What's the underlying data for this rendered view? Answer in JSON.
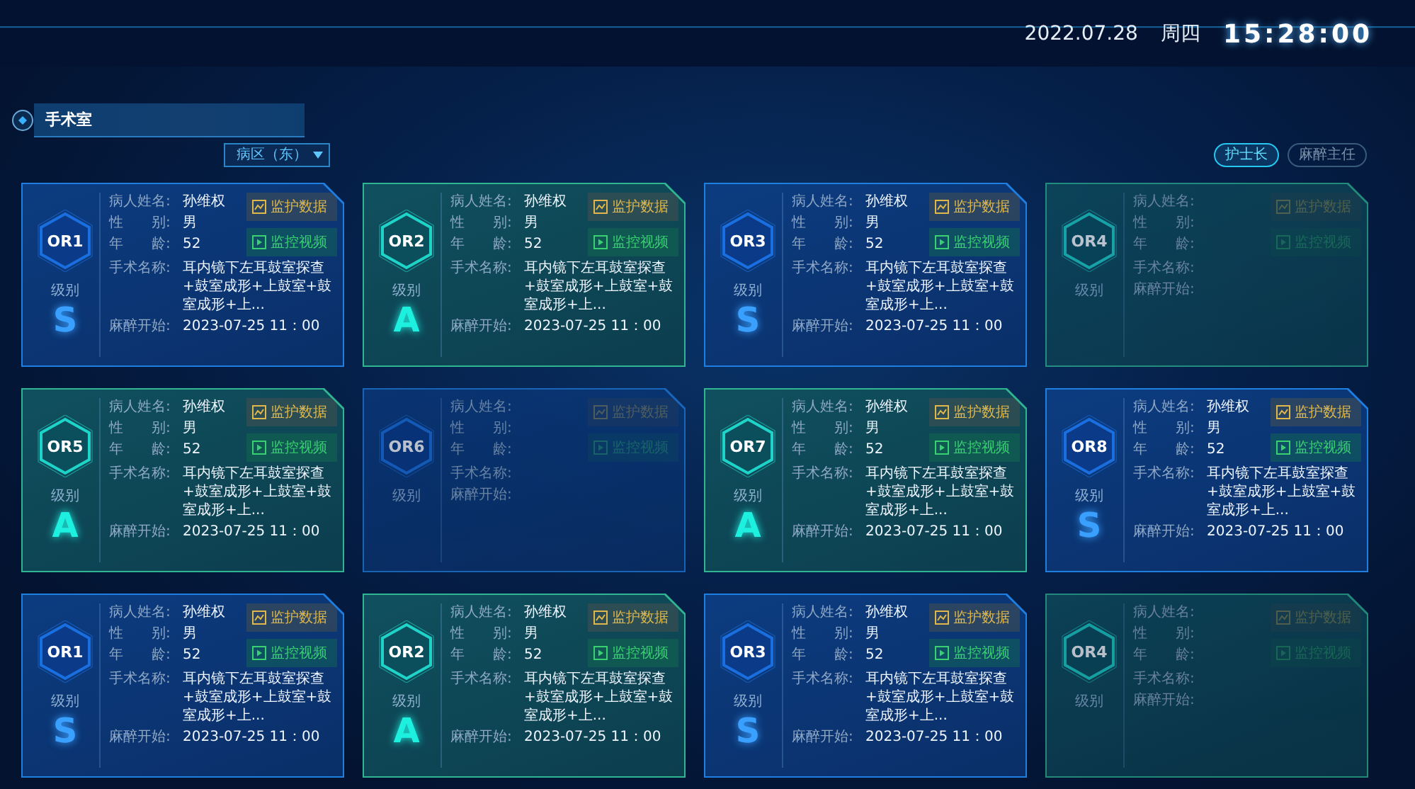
{
  "header": {
    "date": "2022.07.28",
    "weekday": "周四",
    "time": "15:28:00"
  },
  "section": {
    "title": "手术室"
  },
  "ward_select": {
    "value": "病区（东）"
  },
  "roles": [
    {
      "label": "护士长",
      "selected": true
    },
    {
      "label": "麻醉主任",
      "selected": false
    }
  ],
  "cards": [
    {
      "room": "OR1",
      "kind": "blue",
      "grade_label": "级别",
      "grade": "S",
      "fields": [
        {
          "label": "病人姓名:",
          "value": "孙维权"
        },
        {
          "label": "性　　别:",
          "value": "男"
        },
        {
          "label": "年　　龄:",
          "value": "52"
        },
        {
          "label": "手术名称:",
          "value": "耳内镜下左耳鼓室探查+鼓室成形+上鼓室+鼓室成形+上..."
        },
        {
          "label": "麻醉开始:",
          "value": "2023-07-25 11：00"
        }
      ],
      "buttons": [
        {
          "kind": "monitor",
          "label": "监护数据",
          "disabled": false
        },
        {
          "kind": "video",
          "label": "监控视频",
          "disabled": false
        }
      ]
    },
    {
      "room": "OR2",
      "kind": "green",
      "grade_label": "级别",
      "grade": "A",
      "fields": [
        {
          "label": "病人姓名:",
          "value": "孙维权"
        },
        {
          "label": "性　　别:",
          "value": "男"
        },
        {
          "label": "年　　龄:",
          "value": "52"
        },
        {
          "label": "手术名称:",
          "value": "耳内镜下左耳鼓室探查+鼓室成形+上鼓室+鼓室成形+上..."
        },
        {
          "label": "麻醉开始:",
          "value": "2023-07-25 11：00"
        }
      ],
      "buttons": [
        {
          "kind": "monitor",
          "label": "监护数据",
          "disabled": false
        },
        {
          "kind": "video",
          "label": "监控视频",
          "disabled": false
        }
      ]
    },
    {
      "room": "OR3",
      "kind": "blue",
      "grade_label": "级别",
      "grade": "S",
      "fields": [
        {
          "label": "病人姓名:",
          "value": "孙维权"
        },
        {
          "label": "性　　别:",
          "value": "男"
        },
        {
          "label": "年　　龄:",
          "value": "52"
        },
        {
          "label": "手术名称:",
          "value": "耳内镜下左耳鼓室探查+鼓室成形+上鼓室+鼓室成形+上..."
        },
        {
          "label": "麻醉开始:",
          "value": "2023-07-25 11：00"
        }
      ],
      "buttons": [
        {
          "kind": "monitor",
          "label": "监护数据",
          "disabled": false
        },
        {
          "kind": "video",
          "label": "监控视频",
          "disabled": false
        }
      ]
    },
    {
      "room": "OR4",
      "kind": "green",
      "grade_label": "级别",
      "fields": [
        {
          "label": "病人姓名:"
        },
        {
          "label": "性　　别:"
        },
        {
          "label": "年　　龄:"
        },
        {
          "label": "手术名称:"
        },
        {
          "label": "麻醉开始:"
        }
      ],
      "buttons": [
        {
          "kind": "monitor",
          "label": "监护数据",
          "disabled": true
        },
        {
          "kind": "video",
          "label": "监控视频",
          "disabled": true
        }
      ]
    },
    {
      "room": "OR5",
      "kind": "green",
      "grade_label": "级别",
      "grade": "A",
      "fields": [
        {
          "label": "病人姓名:",
          "value": "孙维权"
        },
        {
          "label": "性　　别:",
          "value": "男"
        },
        {
          "label": "年　　龄:",
          "value": "52"
        },
        {
          "label": "手术名称:",
          "value": "耳内镜下左耳鼓室探查+鼓室成形+上鼓室+鼓室成形+上..."
        },
        {
          "label": "麻醉开始:",
          "value": "2023-07-25 11：00"
        }
      ],
      "buttons": [
        {
          "kind": "monitor",
          "label": "监护数据",
          "disabled": false
        },
        {
          "kind": "video",
          "label": "监控视频",
          "disabled": false
        }
      ]
    },
    {
      "room": "OR6",
      "kind": "blue",
      "grade_label": "级别",
      "fields": [
        {
          "label": "病人姓名:"
        },
        {
          "label": "性　　别:"
        },
        {
          "label": "年　　龄:"
        },
        {
          "label": "手术名称:"
        },
        {
          "label": "麻醉开始:"
        }
      ],
      "buttons": [
        {
          "kind": "monitor",
          "label": "监护数据",
          "disabled": true
        },
        {
          "kind": "video",
          "label": "监控视频",
          "disabled": true
        }
      ]
    },
    {
      "room": "OR7",
      "kind": "green",
      "grade_label": "级别",
      "grade": "A",
      "fields": [
        {
          "label": "病人姓名:",
          "value": "孙维权"
        },
        {
          "label": "性　　别:",
          "value": "男"
        },
        {
          "label": "年　　龄:",
          "value": "52"
        },
        {
          "label": "手术名称:",
          "value": "耳内镜下左耳鼓室探查+鼓室成形+上鼓室+鼓室成形+上..."
        },
        {
          "label": "麻醉开始:",
          "value": "2023-07-25 11：00"
        }
      ],
      "buttons": [
        {
          "kind": "monitor",
          "label": "监护数据",
          "disabled": false
        },
        {
          "kind": "video",
          "label": "监控视频",
          "disabled": false
        }
      ]
    },
    {
      "room": "OR8",
      "kind": "blue",
      "grade_label": "级别",
      "grade": "S",
      "fields": [
        {
          "label": "病人姓名:",
          "value": "孙维权"
        },
        {
          "label": "性　　别:",
          "value": "男"
        },
        {
          "label": "年　　龄:",
          "value": "52"
        },
        {
          "label": "手术名称:",
          "value": "耳内镜下左耳鼓室探查+鼓室成形+上鼓室+鼓室成形+上..."
        },
        {
          "label": "麻醉开始:",
          "value": "2023-07-25 11：00"
        }
      ],
      "buttons": [
        {
          "kind": "monitor",
          "label": "监护数据",
          "disabled": false
        },
        {
          "kind": "video",
          "label": "监控视频",
          "disabled": false
        }
      ]
    },
    {
      "room": "OR1",
      "kind": "blue",
      "grade_label": "级别",
      "grade": "S",
      "fields": [
        {
          "label": "病人姓名:",
          "value": "孙维权"
        },
        {
          "label": "性　　别:",
          "value": "男"
        },
        {
          "label": "年　　龄:",
          "value": "52"
        },
        {
          "label": "手术名称:",
          "value": "耳内镜下左耳鼓室探查+鼓室成形+上鼓室+鼓室成形+上..."
        },
        {
          "label": "麻醉开始:",
          "value": "2023-07-25 11：00"
        }
      ],
      "buttons": [
        {
          "kind": "monitor",
          "label": "监护数据",
          "disabled": false
        },
        {
          "kind": "video",
          "label": "监控视频",
          "disabled": false
        }
      ]
    },
    {
      "room": "OR2",
      "kind": "green",
      "grade_label": "级别",
      "grade": "A",
      "fields": [
        {
          "label": "病人姓名:",
          "value": "孙维权"
        },
        {
          "label": "性　　别:",
          "value": "男"
        },
        {
          "label": "年　　龄:",
          "value": "52"
        },
        {
          "label": "手术名称:",
          "value": "耳内镜下左耳鼓室探查+鼓室成形+上鼓室+鼓室成形+上..."
        },
        {
          "label": "麻醉开始:",
          "value": "2023-07-25 11：00"
        }
      ],
      "buttons": [
        {
          "kind": "monitor",
          "label": "监护数据",
          "disabled": false
        },
        {
          "kind": "video",
          "label": "监控视频",
          "disabled": false
        }
      ]
    },
    {
      "room": "OR3",
      "kind": "blue",
      "grade_label": "级别",
      "grade": "S",
      "fields": [
        {
          "label": "病人姓名:",
          "value": "孙维权"
        },
        {
          "label": "性　　别:",
          "value": "男"
        },
        {
          "label": "年　　龄:",
          "value": "52"
        },
        {
          "label": "手术名称:",
          "value": "耳内镜下左耳鼓室探查+鼓室成形+上鼓室+鼓室成形+上..."
        },
        {
          "label": "麻醉开始:",
          "value": "2023-07-25 11：00"
        }
      ],
      "buttons": [
        {
          "kind": "monitor",
          "label": "监护数据",
          "disabled": false
        },
        {
          "kind": "video",
          "label": "监控视频",
          "disabled": false
        }
      ]
    },
    {
      "room": "OR4",
      "kind": "green",
      "grade_label": "级别",
      "fields": [
        {
          "label": "病人姓名:"
        },
        {
          "label": "性　　别:"
        },
        {
          "label": "年　　龄:"
        },
        {
          "label": "手术名称:"
        },
        {
          "label": "麻醉开始:"
        }
      ],
      "buttons": [
        {
          "kind": "monitor",
          "label": "监护数据",
          "disabled": true
        },
        {
          "kind": "video",
          "label": "监控视频",
          "disabled": true
        }
      ]
    }
  ]
}
